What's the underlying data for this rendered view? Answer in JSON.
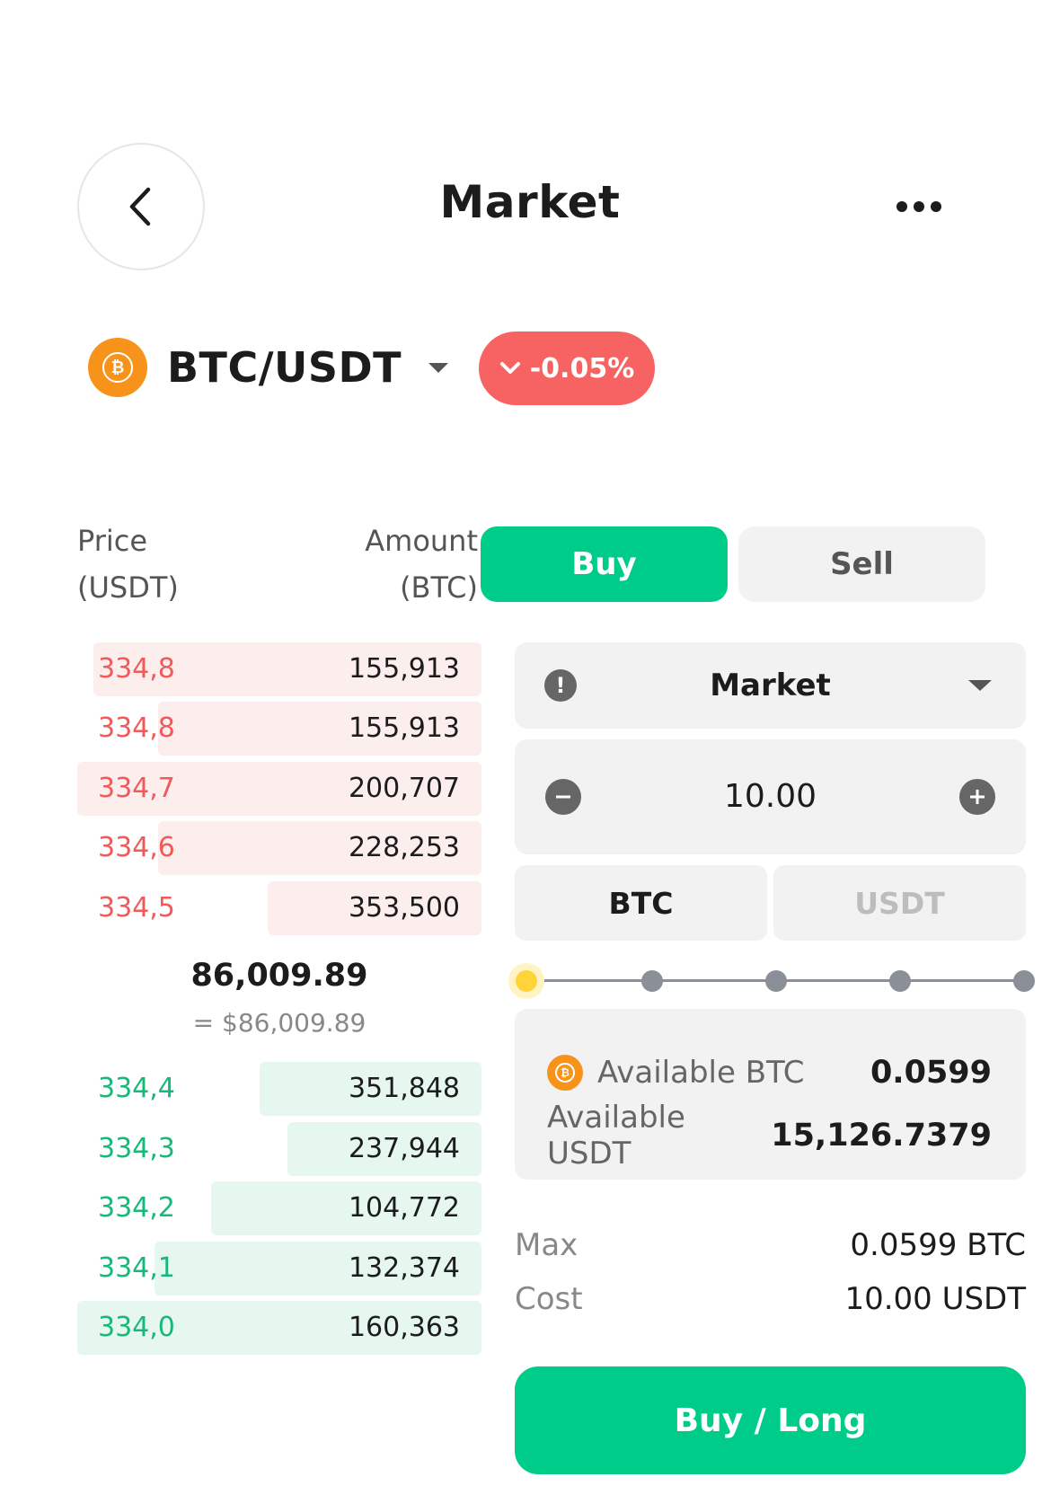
{
  "header": {
    "title": "Market"
  },
  "pair": {
    "name": "BTC/USDT",
    "coin_icon": "bitcoin-icon",
    "change": "-0.05%",
    "change_color": "#f76363"
  },
  "orderbook": {
    "price_header": [
      "Price",
      "(USDT)"
    ],
    "amount_header": [
      "Amount",
      "(BTC)"
    ],
    "asks": [
      {
        "price": "334,8",
        "amount": "155,913",
        "depth": 0.96
      },
      {
        "price": "334,8",
        "amount": "155,913",
        "depth": 0.8
      },
      {
        "price": "334,7",
        "amount": "200,707",
        "depth": 1.0
      },
      {
        "price": "334,6",
        "amount": "228,253",
        "depth": 0.8
      },
      {
        "price": "334,5",
        "amount": "353,500",
        "depth": 0.53
      }
    ],
    "mid_price": "86,009.89",
    "mid_usd": "= $86,009.89",
    "bids": [
      {
        "price": "334,4",
        "amount": "351,848",
        "depth": 0.55
      },
      {
        "price": "334,3",
        "amount": "237,944",
        "depth": 0.48
      },
      {
        "price": "334,2",
        "amount": "104,772",
        "depth": 0.67
      },
      {
        "price": "334,1",
        "amount": "132,374",
        "depth": 0.81
      },
      {
        "price": "334,0",
        "amount": "160,363",
        "depth": 1.0
      }
    ]
  },
  "tabs": {
    "buy": "Buy",
    "sell": "Sell",
    "active": "buy"
  },
  "form": {
    "order_type": "Market",
    "amount": "10.00",
    "units": [
      "BTC",
      "USDT"
    ],
    "selected_unit": "BTC",
    "slider_level": 0,
    "available_btc_label": "Available BTC",
    "available_btc": "0.0599",
    "available_usdt_label": "Available USDT",
    "available_usdt": "15,126.7379",
    "max_label": "Max",
    "max_value": "0.0599 BTC",
    "cost_label": "Cost",
    "cost_value": "10.00 USDT",
    "submit": "Buy / Long"
  },
  "colors": {
    "buy": "#00cc8a",
    "ask": "#f05a5a",
    "bid": "#17b978",
    "slider_active": "#ffd43b"
  }
}
